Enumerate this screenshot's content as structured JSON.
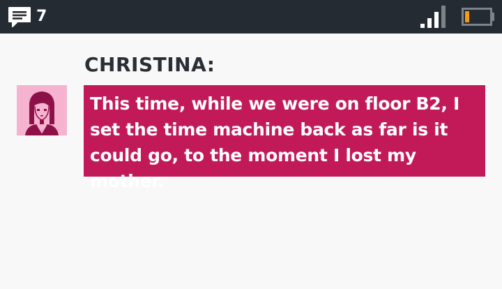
{
  "status_bar": {
    "message_icon": "message-icon",
    "message_count": "7",
    "signal_icon": "signal-icon",
    "signal_level": 0.75,
    "battery_icon": "battery-icon",
    "battery_level": 0.2
  },
  "dialogue": {
    "speaker": "CHRISTINA:",
    "avatar_icon": "christina-portrait",
    "text": "This time, while we were on floor B2, I set the time machine back as far is it could go, to the moment I lost my mother."
  },
  "colors": {
    "status_bar_bg": "#252b33",
    "bubble_bg": "#c21a58",
    "avatar_bg": "#f6b3d0",
    "avatar_ink": "#8e1048",
    "battery_charge": "#f39c12",
    "background": "#f8f8f8"
  }
}
